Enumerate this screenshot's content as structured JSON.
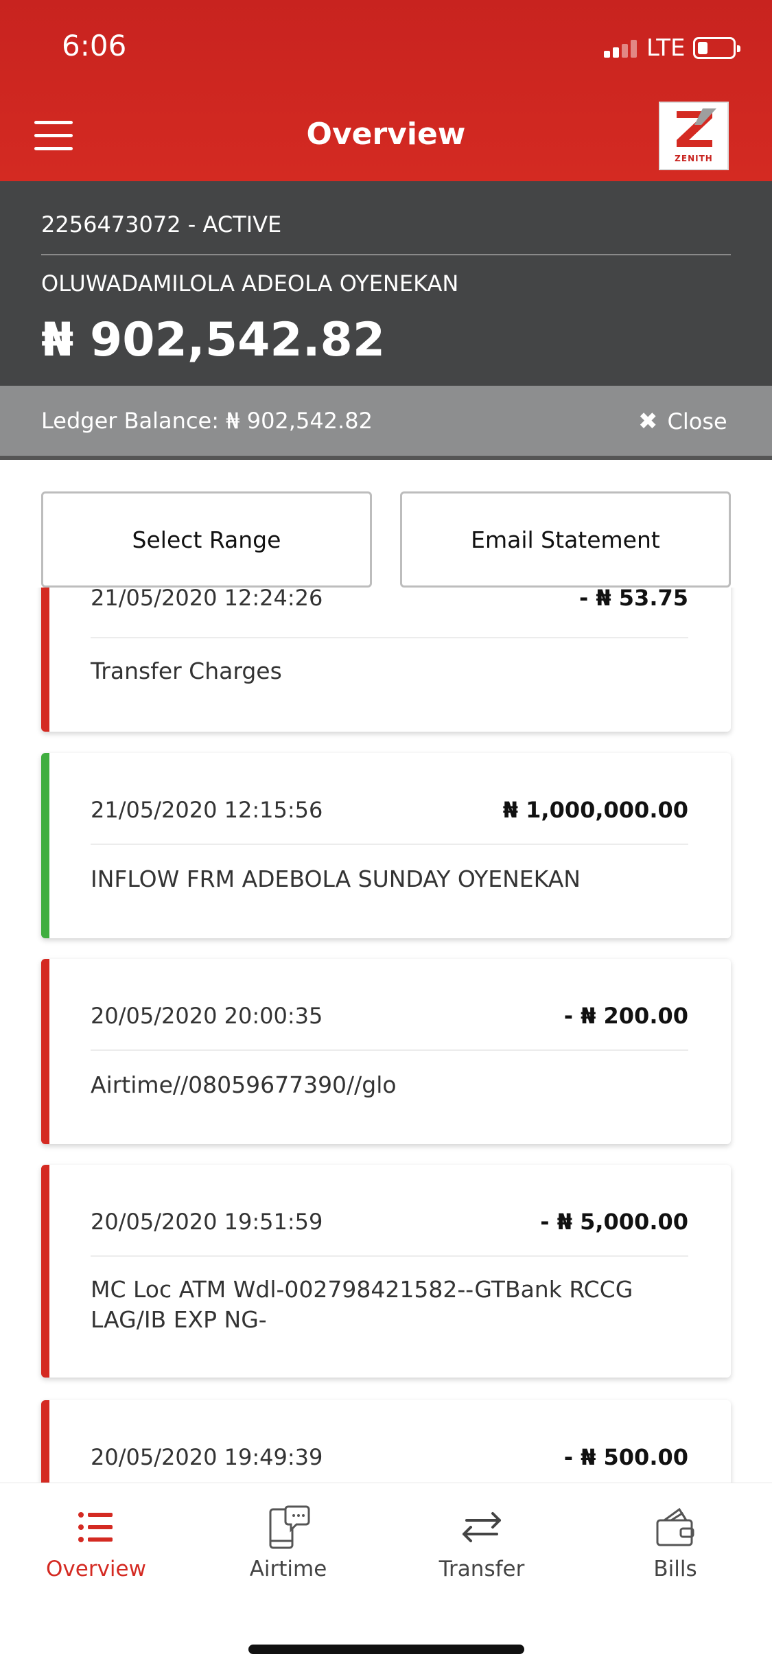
{
  "status_bar": {
    "time": "6:06",
    "network": "LTE"
  },
  "header": {
    "title": "Overview",
    "logo_text": "ZENITH"
  },
  "account": {
    "number_status": "2256473072  - ACTIVE",
    "name": "OLUWADAMILOLA ADEOLA OYENEKAN",
    "balance": "₦ 902,542.82",
    "ledger": "Ledger Balance: ₦ 902,542.82",
    "close_label": "Close"
  },
  "actions": {
    "select_range": "Select Range",
    "email_statement": "Email Statement"
  },
  "transactions": [
    {
      "date": "21/05/2020 12:24:26",
      "amount": "- ₦ 53.75",
      "desc": "Transfer Charges",
      "type": "debit"
    },
    {
      "date": "21/05/2020 12:15:56",
      "amount": "₦ 1,000,000.00",
      "desc": "INFLOW FRM ADEBOLA SUNDAY OYENEKAN",
      "type": "credit"
    },
    {
      "date": "20/05/2020 20:00:35",
      "amount": "- ₦ 200.00",
      "desc": "Airtime//08059677390//glo",
      "type": "debit"
    },
    {
      "date": "20/05/2020 19:51:59",
      "amount": "- ₦ 5,000.00",
      "desc": "MC Loc ATM Wdl-002798421582--GTBank RCCG LAG/IB EXP    NG-",
      "type": "debit"
    },
    {
      "date": "20/05/2020 19:49:39",
      "amount": "- ₦ 500.00",
      "desc": "",
      "type": "debit"
    }
  ],
  "tabs": [
    {
      "label": "Overview",
      "icon": "list-icon",
      "active": true
    },
    {
      "label": "Airtime",
      "icon": "phone-chat-icon",
      "active": false
    },
    {
      "label": "Transfer",
      "icon": "transfer-arrows-icon",
      "active": false
    },
    {
      "label": "Bills",
      "icon": "wallet-icon",
      "active": false
    }
  ],
  "colors": {
    "brand_red": "#d42a22",
    "credit_green": "#3fae3f",
    "panel_dark": "#444546"
  }
}
